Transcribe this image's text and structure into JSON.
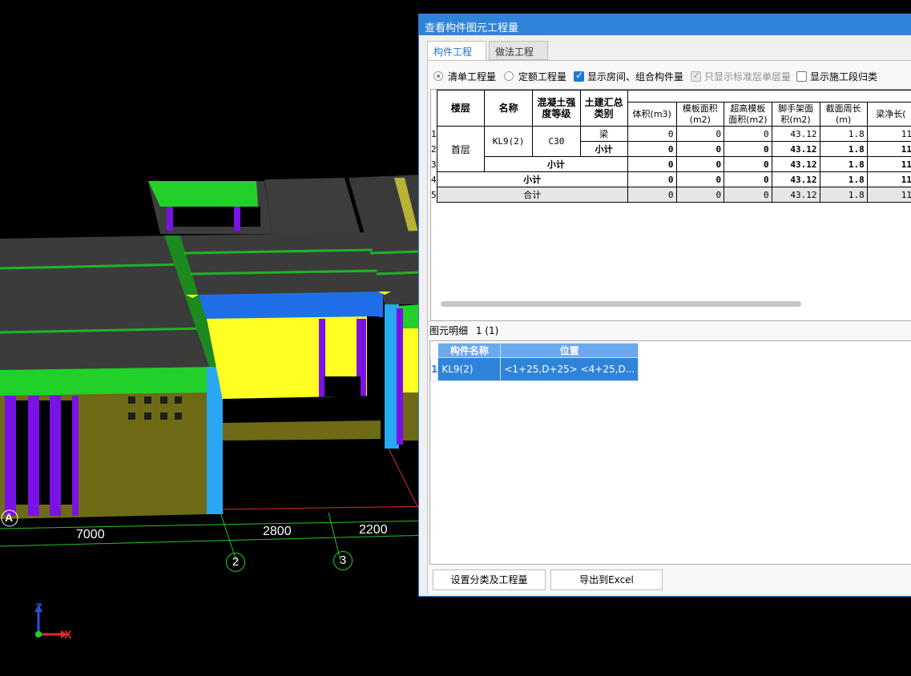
{
  "viewport": {
    "dimensions": [
      "7000",
      "2800",
      "2200"
    ],
    "axis_bubbles": [
      "2",
      "3"
    ],
    "grid_letter": "A",
    "axis_z": "Z",
    "axis_x": "X"
  },
  "dialog": {
    "title": "查看构件图元工程量",
    "tabs": [
      "构件工程量",
      "做法工程量"
    ],
    "options": {
      "list_qty": "清单工程量",
      "quota_qty": "定额工程量",
      "show_room": "显示房间、组合构件量",
      "only_std_floor": "只显示标准层单层量",
      "show_section": "显示施工段归类"
    },
    "table": {
      "headers": {
        "floor": "楼层",
        "name": "名称",
        "concrete": "混凝土强度等级",
        "category": "土建汇总类别",
        "volume": "体积(m3)",
        "formwork": "模板面积(m2)",
        "high_formwork": "超高模板面积(m2)",
        "scaffold": "脚手架面积(m2)",
        "perimeter": "截面周长(m)",
        "beam_len": "梁净长("
      },
      "floor": "首层",
      "name": "KL9(2)",
      "grade": "C30",
      "rows": [
        {
          "idx": "1",
          "label": "梁",
          "v": [
            "0",
            "0",
            "0",
            "43.12",
            "1.8",
            "11"
          ]
        },
        {
          "idx": "2",
          "label": "小计",
          "v": [
            "0",
            "0",
            "0",
            "43.12",
            "1.8",
            "11"
          ]
        },
        {
          "idx": "3",
          "label": "小计",
          "v": [
            "0",
            "0",
            "0",
            "43.12",
            "1.8",
            "11"
          ]
        },
        {
          "idx": "4",
          "label": "小计",
          "v": [
            "0",
            "0",
            "0",
            "43.12",
            "1.8",
            "11"
          ]
        },
        {
          "idx": "5",
          "label": "合计",
          "v": [
            "0",
            "0",
            "0",
            "43.12",
            "1.8",
            "11"
          ]
        }
      ]
    },
    "detail": {
      "title": "图元明细",
      "count": "1 (1)",
      "headers": [
        "构件名称",
        "位置"
      ],
      "rows": [
        {
          "idx": "1",
          "name": "KL9(2)",
          "location": "<1+25,D+25> <4+25,D..."
        }
      ]
    },
    "buttons": {
      "classify": "设置分类及工程量",
      "export": "导出到Excel"
    }
  }
}
